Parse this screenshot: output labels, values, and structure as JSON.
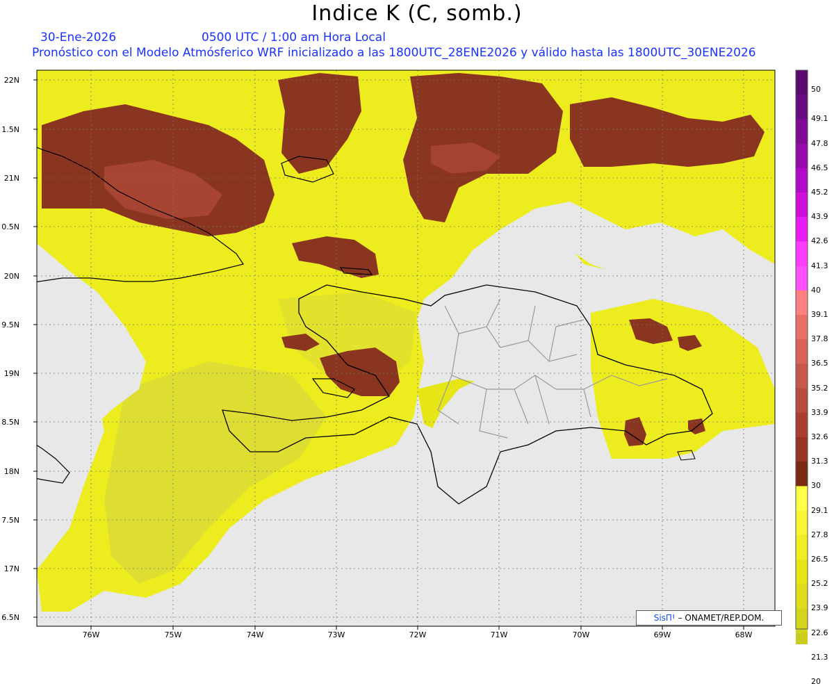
{
  "title": "Indice K (C, somb.)",
  "header": {
    "date": "30-Ene-2026",
    "time": "0500 UTC / 1:00 am Hora Local",
    "description": "Pronóstico con el Modelo Atmósferico WRF inicializado a las 1800UTC_28ENE2026 y válido hasta las  1800UTC_30ENE2026"
  },
  "axes": {
    "y_labels": [
      "22N",
      "1.5N",
      "21N",
      "0.5N",
      "20N",
      "9.5N",
      "19N",
      "8.5N",
      "18N",
      "7.5N",
      "17N",
      "6.5N"
    ],
    "x_labels": [
      "76W",
      "75W",
      "74W",
      "73W",
      "72W",
      "71W",
      "70W",
      "69W",
      "68W"
    ]
  },
  "colorbar": {
    "labels": [
      "50",
      "49.1",
      "47.8",
      "46.5",
      "45.2",
      "43.9",
      "42.6",
      "41.3",
      "40",
      "39.1",
      "37.8",
      "36.5",
      "35.2",
      "33.9",
      "32.6",
      "31.3",
      "30",
      "29.1",
      "27.8",
      "26.5",
      "25.2",
      "23.9",
      "22.6",
      "21.3",
      "20"
    ],
    "colors": [
      "#5a0a6e",
      "#6b0a80",
      "#800a96",
      "#960aad",
      "#b10ac8",
      "#cc10dc",
      "#e61ef0",
      "#ff3cff",
      "#ff50ff",
      "#ff8080",
      "#e87068",
      "#d86458",
      "#c8584a",
      "#b84c3c",
      "#a8402e",
      "#983420",
      "#7a2a10",
      "#ffff44",
      "#f6f632",
      "#eeee22",
      "#e6e616",
      "#dede1a",
      "#d4d41a",
      "#cccc1e",
      "#c4c41e"
    ],
    "below_color": "#e8e8e8"
  },
  "legend_colors": {
    "high_k": "#8a3520",
    "mid_k": "#ecec1e",
    "low_k": "#d8d83a",
    "no_data": "#e8e8e8"
  },
  "credit": {
    "brand": "SisПꞋ",
    "text": "– ONAMET/REP.DOM."
  }
}
